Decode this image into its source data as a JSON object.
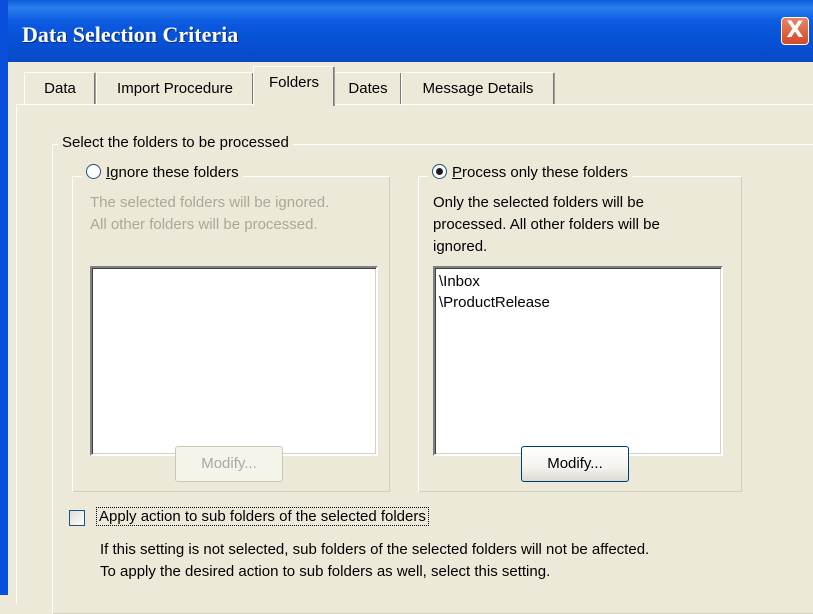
{
  "window": {
    "title": "Data Selection Criteria",
    "close_label": "X"
  },
  "tabs": [
    {
      "label": "Data"
    },
    {
      "label": "Import Procedure"
    },
    {
      "label": "Folders"
    },
    {
      "label": "Dates"
    },
    {
      "label": "Message Details"
    }
  ],
  "active_tab": "Folders",
  "folders": {
    "group_title": "Select the folders to be processed",
    "ignore": {
      "radio_label": "Ignore these folders",
      "checked": false,
      "enabled": false,
      "description_line1": "The selected folders will be ignored.",
      "description_line2": "All other folders will be processed.",
      "items": [],
      "modify_label": "Modify..."
    },
    "process": {
      "radio_label": "Process only these folders",
      "checked": true,
      "enabled": true,
      "description_line1": "Only the selected folders will be",
      "description_line2": "processed. All other folders will be",
      "description_line3": "ignored.",
      "items": [
        "\\Inbox",
        "\\ProductRelease"
      ],
      "modify_label": "Modify..."
    },
    "subfolders": {
      "checkbox_label": "Apply action to sub folders of the selected folders",
      "checked": false,
      "help_line1": "If this setting is not selected, sub folders of the selected folders will not be affected.",
      "help_line2": "To apply the desired action to sub folders as well, select this setting."
    }
  },
  "colors": {
    "titlebar": "#0750d4",
    "dialog_bg": "#ece9d8",
    "close_button": "#d44a24",
    "disabled_text": "#aca899"
  }
}
